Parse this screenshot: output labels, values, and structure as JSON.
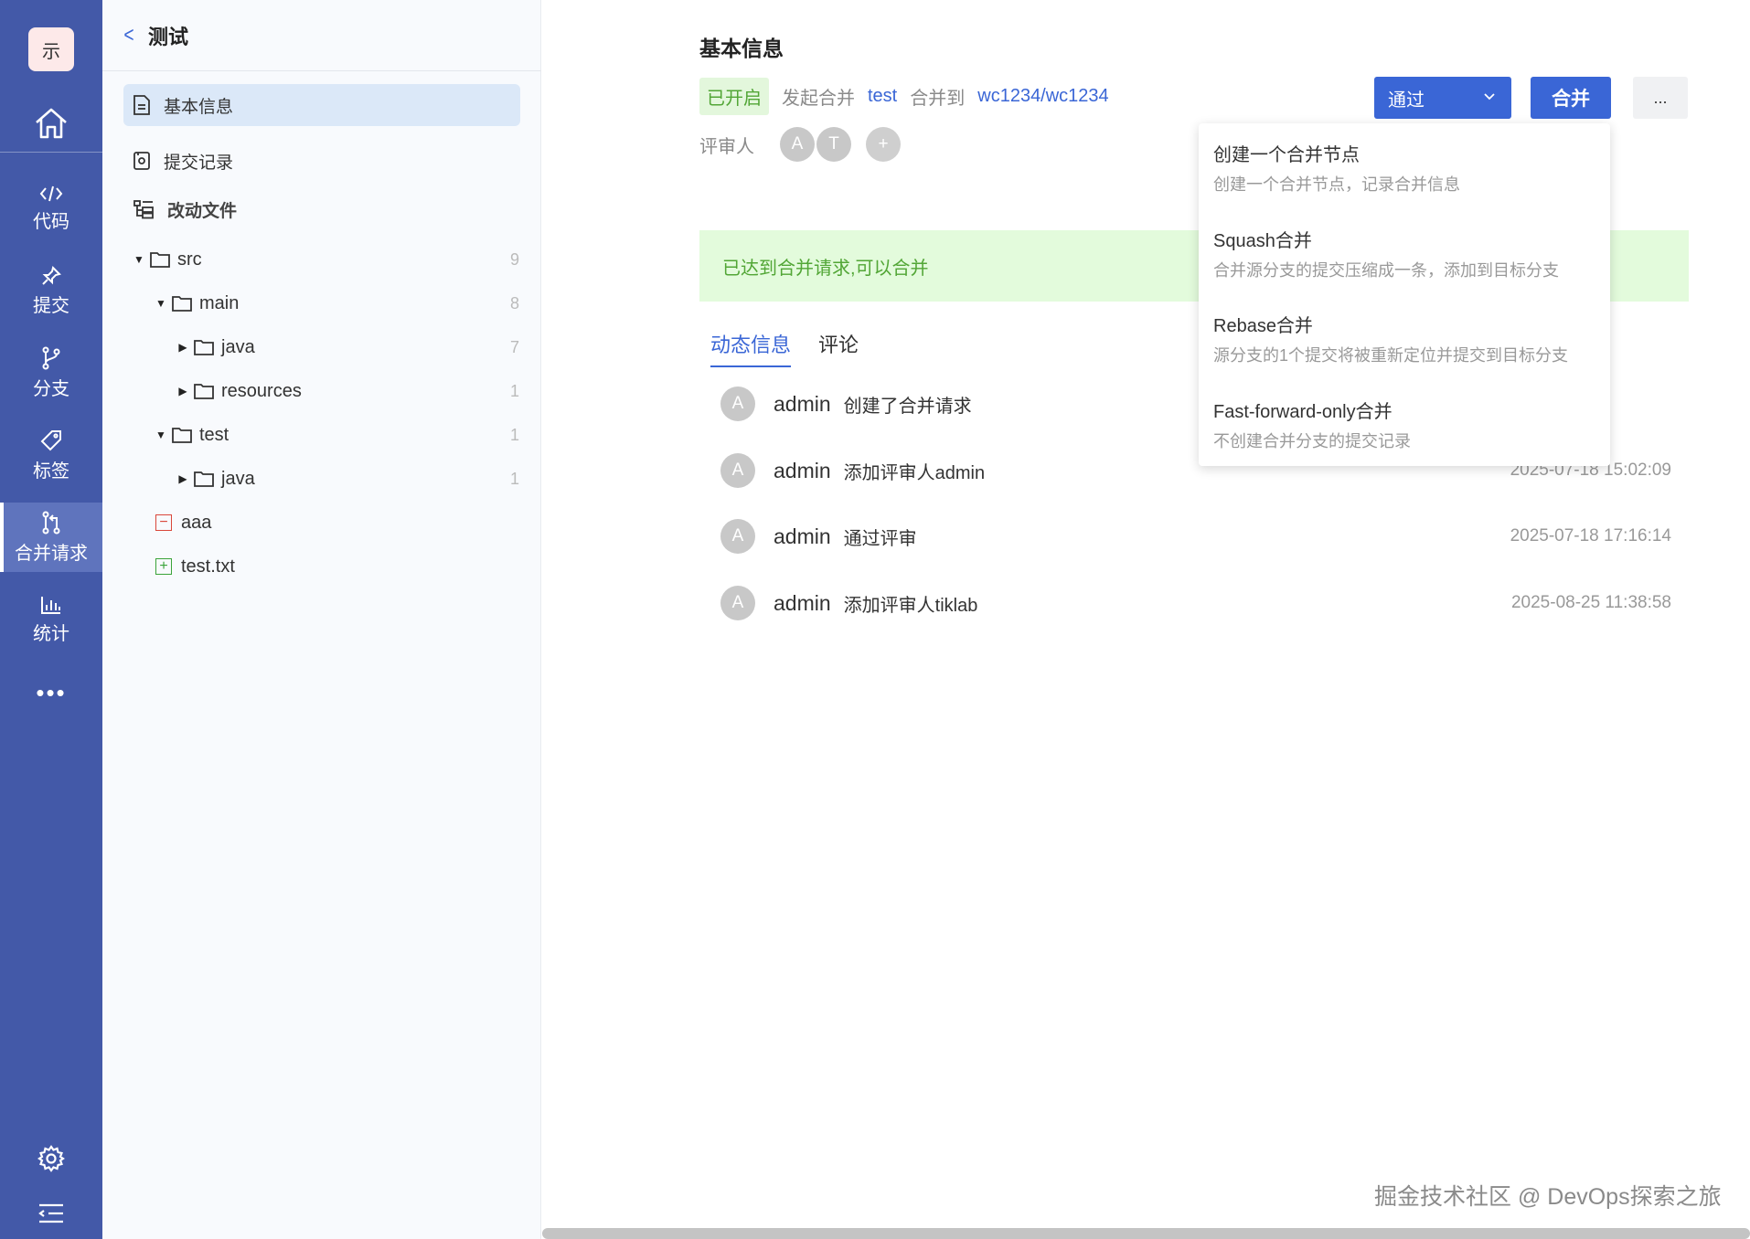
{
  "nav": {
    "logo": "示",
    "items": [
      {
        "label": "代码",
        "icon": "code-icon"
      },
      {
        "label": "提交",
        "icon": "pin-icon"
      },
      {
        "label": "分支",
        "icon": "branch-icon"
      },
      {
        "label": "标签",
        "icon": "tag-icon"
      },
      {
        "label": "合并请求",
        "icon": "merge-request-icon",
        "active": true
      },
      {
        "label": "统计",
        "icon": "chart-icon"
      }
    ],
    "more": "•••"
  },
  "panel": {
    "title": "测试",
    "menu": [
      {
        "label": "基本信息",
        "active": true
      },
      {
        "label": "提交记录"
      },
      {
        "label": "改动文件"
      }
    ],
    "tree": [
      {
        "name": "src",
        "count": "9"
      },
      {
        "name": "main",
        "count": "8"
      },
      {
        "name": "java",
        "count": "7"
      },
      {
        "name": "resources",
        "count": "1"
      },
      {
        "name": "test",
        "count": "1"
      },
      {
        "name": "java",
        "count": "1"
      },
      {
        "name": "aaa",
        "status": "deleted"
      },
      {
        "name": "test.txt",
        "status": "added"
      }
    ]
  },
  "main": {
    "title": "基本信息",
    "status": "已开启",
    "initiate": "发起合并",
    "source_branch": "test",
    "merge_to": "合并到",
    "target_branch": "wc1234/wc1234",
    "reviewers_label": "评审人",
    "reviewers": [
      "A",
      "T"
    ],
    "add_reviewer": "+",
    "approve_button": "通过",
    "merge_button": "合并",
    "more_button": "...",
    "banner": "已达到合并请求,可以合并",
    "tabs": [
      "动态信息",
      "评论"
    ],
    "activities": [
      {
        "avatar": "A",
        "user": "admin",
        "text": "创建了合并请求",
        "time": ""
      },
      {
        "avatar": "A",
        "user": "admin",
        "text": "添加评审人admin",
        "time": "2025-07-18 15:02:09"
      },
      {
        "avatar": "A",
        "user": "admin",
        "text": "通过评审",
        "time": "2025-07-18 17:16:14"
      },
      {
        "avatar": "A",
        "user": "admin",
        "text": "添加评审人tiklab",
        "time": "2025-08-25 11:38:58"
      }
    ]
  },
  "dropdown": [
    {
      "title": "创建一个合并节点",
      "desc": "创建一个合并节点，记录合并信息"
    },
    {
      "title": "Squash合并",
      "desc": "合并源分支的提交压缩成一条，添加到目标分支"
    },
    {
      "title": "Rebase合并",
      "desc": "源分支的1个提交将被重新定位并提交到目标分支"
    },
    {
      "title": "Fast-forward-only合并",
      "desc": "不创建合并分支的提交记录"
    }
  ],
  "watermark": "掘金技术社区 @ DevOps探索之旅",
  "colors": {
    "nav_bg": "#4359a8",
    "accent": "#3a66d6",
    "success": "#52a636"
  }
}
